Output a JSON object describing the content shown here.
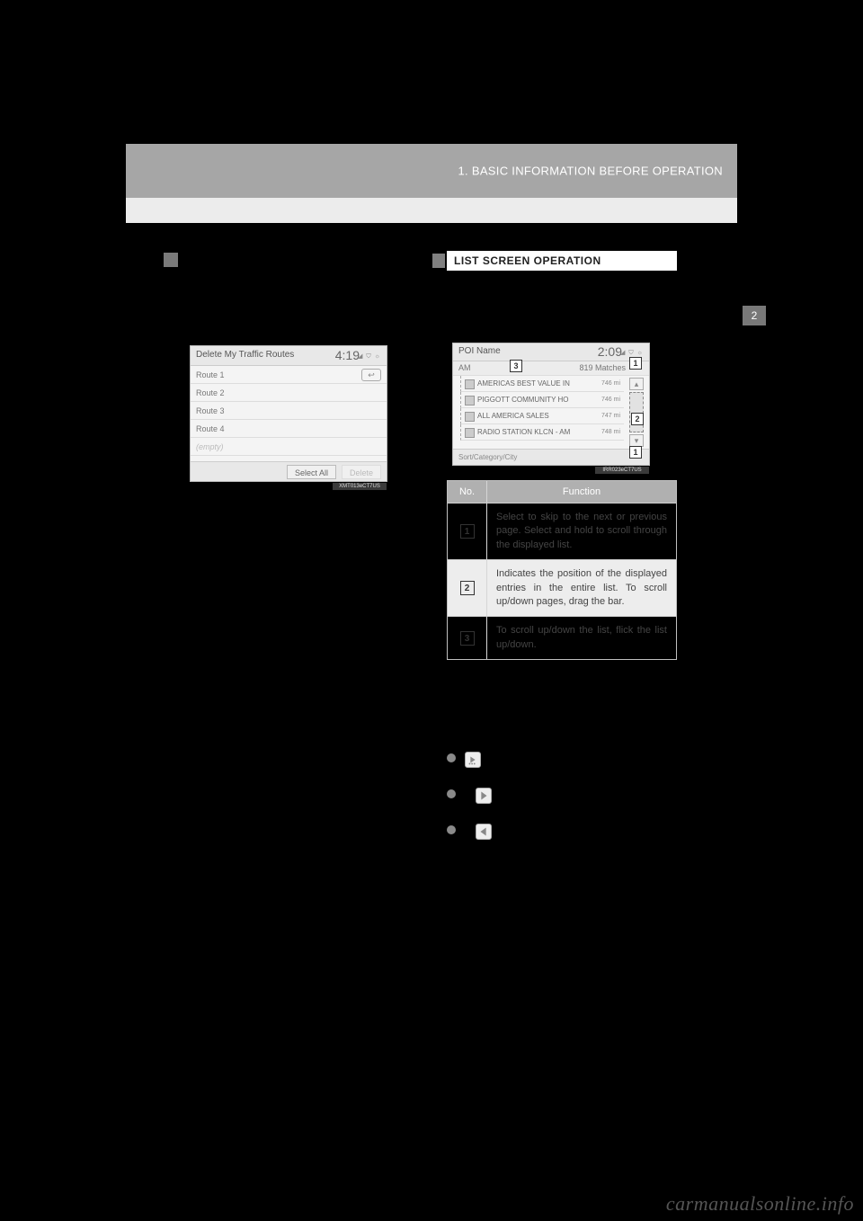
{
  "header": {
    "section_label": "1. BASIC INFORMATION BEFORE OPERATION"
  },
  "side_tab": "2",
  "right_heading": "LIST SCREEN OPERATION",
  "shot1": {
    "title": "Delete My Traffic Routes",
    "clock": "4:19",
    "status_icons": "◢ ⛉ ☼",
    "rows": [
      "Route 1",
      "Route 2",
      "Route 3",
      "Route 4",
      "(empty)"
    ],
    "back_glyph": "↩",
    "footer": {
      "select_all": "Select All",
      "delete": "Delete"
    },
    "code": "XMT013eCT7US"
  },
  "shot2": {
    "title": "POI Name",
    "clock": "2:09",
    "status_icons": "◢ ⛉ ☼",
    "subbar_left": "AM",
    "subbar_right": "819 Matches",
    "rows": [
      {
        "label": "AMERICAS BEST VALUE IN",
        "dist": "746 mi"
      },
      {
        "label": "PIGGOTT COMMUNITY HO",
        "dist": "746 mi"
      },
      {
        "label": "ALL AMERICA SALES",
        "dist": "747 mi"
      },
      {
        "label": "RADIO STATION KLCN - AM",
        "dist": "748 mi"
      }
    ],
    "footer": "Sort/Category/City",
    "code": "IRR023eCT7US",
    "callouts": {
      "top_right": "1",
      "scroll": "2",
      "subbar": "3",
      "bottom_right": "1"
    }
  },
  "ftable": {
    "head": {
      "no": "No.",
      "fn": "Function"
    },
    "rows": [
      {
        "n": "1",
        "text": "Select to skip to the next or previous page.\nSelect and hold to scroll through the displayed list."
      },
      {
        "n": "2",
        "text": "Indicates the position of the displayed entries in the entire list.\nTo scroll up/down pages, drag the bar."
      },
      {
        "n": "3",
        "text": "To scroll up/down the list, flick the list up/down."
      }
    ]
  },
  "watermark": "carmanualsonline.info"
}
